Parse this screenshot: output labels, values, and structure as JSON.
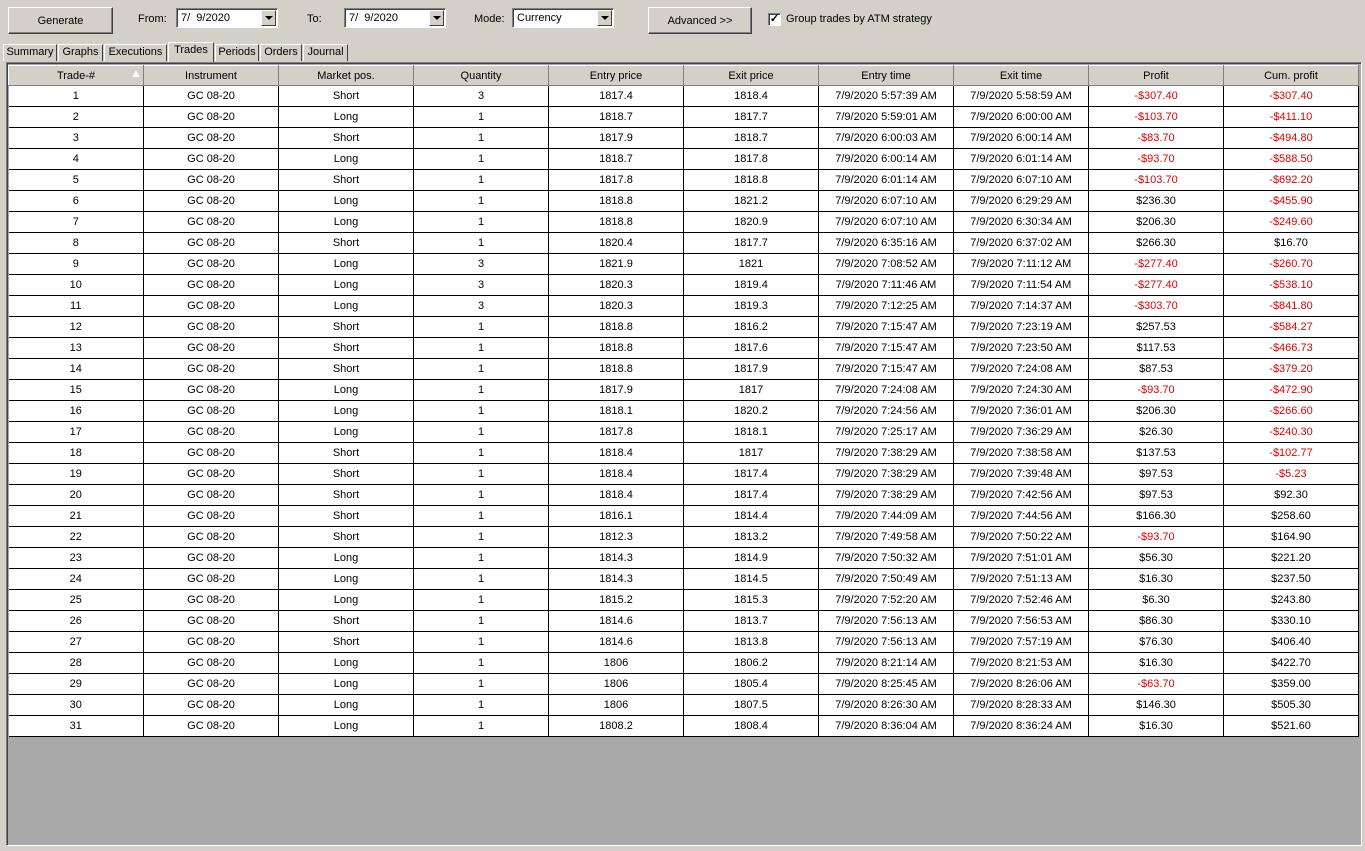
{
  "toolbar": {
    "generate_label": "Generate",
    "from_label": "From:",
    "from_value": "7/  9/2020",
    "to_label": "To:",
    "to_value": "7/  9/2020",
    "mode_label": "Mode:",
    "mode_value": "Currency",
    "advanced_label": "Advanced >>",
    "group_checkbox_label": "Group trades by ATM strategy",
    "group_checked": "✓"
  },
  "tabs": [
    "Summary",
    "Graphs",
    "Executions",
    "Trades",
    "Periods",
    "Orders",
    "Journal"
  ],
  "active_tab": "Trades",
  "colors": {
    "negative": "#e00000",
    "background": "#d4d0c8",
    "empty_grid": "#a9a9a9"
  },
  "table": {
    "columns": [
      "Trade-#",
      "Instrument",
      "Market pos.",
      "Quantity",
      "Entry price",
      "Exit price",
      "Entry time",
      "Exit time",
      "Profit",
      "Cum. profit"
    ],
    "sort_icon": "sort-ascending-icon",
    "rows": [
      [
        "1",
        "GC 08-20",
        "Short",
        "3",
        "1817.4",
        "1818.4",
        "7/9/2020 5:57:39 AM",
        "7/9/2020 5:58:59 AM",
        "-$307.40",
        "-$307.40"
      ],
      [
        "2",
        "GC 08-20",
        "Long",
        "1",
        "1818.7",
        "1817.7",
        "7/9/2020 5:59:01 AM",
        "7/9/2020 6:00:00 AM",
        "-$103.70",
        "-$411.10"
      ],
      [
        "3",
        "GC 08-20",
        "Short",
        "1",
        "1817.9",
        "1818.7",
        "7/9/2020 6:00:03 AM",
        "7/9/2020 6:00:14 AM",
        "-$83.70",
        "-$494.80"
      ],
      [
        "4",
        "GC 08-20",
        "Long",
        "1",
        "1818.7",
        "1817.8",
        "7/9/2020 6:00:14 AM",
        "7/9/2020 6:01:14 AM",
        "-$93.70",
        "-$588.50"
      ],
      [
        "5",
        "GC 08-20",
        "Short",
        "1",
        "1817.8",
        "1818.8",
        "7/9/2020 6:01:14 AM",
        "7/9/2020 6:07:10 AM",
        "-$103.70",
        "-$692.20"
      ],
      [
        "6",
        "GC 08-20",
        "Long",
        "1",
        "1818.8",
        "1821.2",
        "7/9/2020 6:07:10 AM",
        "7/9/2020 6:29:29 AM",
        "$236.30",
        "-$455.90"
      ],
      [
        "7",
        "GC 08-20",
        "Long",
        "1",
        "1818.8",
        "1820.9",
        "7/9/2020 6:07:10 AM",
        "7/9/2020 6:30:34 AM",
        "$206.30",
        "-$249.60"
      ],
      [
        "8",
        "GC 08-20",
        "Short",
        "1",
        "1820.4",
        "1817.7",
        "7/9/2020 6:35:16 AM",
        "7/9/2020 6:37:02 AM",
        "$266.30",
        "$16.70"
      ],
      [
        "9",
        "GC 08-20",
        "Long",
        "3",
        "1821.9",
        "1821",
        "7/9/2020 7:08:52 AM",
        "7/9/2020 7:11:12 AM",
        "-$277.40",
        "-$260.70"
      ],
      [
        "10",
        "GC 08-20",
        "Long",
        "3",
        "1820.3",
        "1819.4",
        "7/9/2020 7:11:46 AM",
        "7/9/2020 7:11:54 AM",
        "-$277.40",
        "-$538.10"
      ],
      [
        "11",
        "GC 08-20",
        "Long",
        "3",
        "1820.3",
        "1819.3",
        "7/9/2020 7:12:25 AM",
        "7/9/2020 7:14:37 AM",
        "-$303.70",
        "-$841.80"
      ],
      [
        "12",
        "GC 08-20",
        "Short",
        "1",
        "1818.8",
        "1816.2",
        "7/9/2020 7:15:47 AM",
        "7/9/2020 7:23:19 AM",
        "$257.53",
        "-$584.27"
      ],
      [
        "13",
        "GC 08-20",
        "Short",
        "1",
        "1818.8",
        "1817.6",
        "7/9/2020 7:15:47 AM",
        "7/9/2020 7:23:50 AM",
        "$117.53",
        "-$466.73"
      ],
      [
        "14",
        "GC 08-20",
        "Short",
        "1",
        "1818.8",
        "1817.9",
        "7/9/2020 7:15:47 AM",
        "7/9/2020 7:24:08 AM",
        "$87.53",
        "-$379.20"
      ],
      [
        "15",
        "GC 08-20",
        "Long",
        "1",
        "1817.9",
        "1817",
        "7/9/2020 7:24:08 AM",
        "7/9/2020 7:24:30 AM",
        "-$93.70",
        "-$472.90"
      ],
      [
        "16",
        "GC 08-20",
        "Long",
        "1",
        "1818.1",
        "1820.2",
        "7/9/2020 7:24:56 AM",
        "7/9/2020 7:36:01 AM",
        "$206.30",
        "-$266.60"
      ],
      [
        "17",
        "GC 08-20",
        "Long",
        "1",
        "1817.8",
        "1818.1",
        "7/9/2020 7:25:17 AM",
        "7/9/2020 7:36:29 AM",
        "$26.30",
        "-$240.30"
      ],
      [
        "18",
        "GC 08-20",
        "Short",
        "1",
        "1818.4",
        "1817",
        "7/9/2020 7:38:29 AM",
        "7/9/2020 7:38:58 AM",
        "$137.53",
        "-$102.77"
      ],
      [
        "19",
        "GC 08-20",
        "Short",
        "1",
        "1818.4",
        "1817.4",
        "7/9/2020 7:38:29 AM",
        "7/9/2020 7:39:48 AM",
        "$97.53",
        "-$5.23"
      ],
      [
        "20",
        "GC 08-20",
        "Short",
        "1",
        "1818.4",
        "1817.4",
        "7/9/2020 7:38:29 AM",
        "7/9/2020 7:42:56 AM",
        "$97.53",
        "$92.30"
      ],
      [
        "21",
        "GC 08-20",
        "Short",
        "1",
        "1816.1",
        "1814.4",
        "7/9/2020 7:44:09 AM",
        "7/9/2020 7:44:56 AM",
        "$166.30",
        "$258.60"
      ],
      [
        "22",
        "GC 08-20",
        "Short",
        "1",
        "1812.3",
        "1813.2",
        "7/9/2020 7:49:58 AM",
        "7/9/2020 7:50:22 AM",
        "-$93.70",
        "$164.90"
      ],
      [
        "23",
        "GC 08-20",
        "Long",
        "1",
        "1814.3",
        "1814.9",
        "7/9/2020 7:50:32 AM",
        "7/9/2020 7:51:01 AM",
        "$56.30",
        "$221.20"
      ],
      [
        "24",
        "GC 08-20",
        "Long",
        "1",
        "1814.3",
        "1814.5",
        "7/9/2020 7:50:49 AM",
        "7/9/2020 7:51:13 AM",
        "$16.30",
        "$237.50"
      ],
      [
        "25",
        "GC 08-20",
        "Long",
        "1",
        "1815.2",
        "1815.3",
        "7/9/2020 7:52:20 AM",
        "7/9/2020 7:52:46 AM",
        "$6.30",
        "$243.80"
      ],
      [
        "26",
        "GC 08-20",
        "Short",
        "1",
        "1814.6",
        "1813.7",
        "7/9/2020 7:56:13 AM",
        "7/9/2020 7:56:53 AM",
        "$86.30",
        "$330.10"
      ],
      [
        "27",
        "GC 08-20",
        "Short",
        "1",
        "1814.6",
        "1813.8",
        "7/9/2020 7:56:13 AM",
        "7/9/2020 7:57:19 AM",
        "$76.30",
        "$406.40"
      ],
      [
        "28",
        "GC 08-20",
        "Long",
        "1",
        "1806",
        "1806.2",
        "7/9/2020 8:21:14 AM",
        "7/9/2020 8:21:53 AM",
        "$16.30",
        "$422.70"
      ],
      [
        "29",
        "GC 08-20",
        "Long",
        "1",
        "1806",
        "1805.4",
        "7/9/2020 8:25:45 AM",
        "7/9/2020 8:26:06 AM",
        "-$63.70",
        "$359.00"
      ],
      [
        "30",
        "GC 08-20",
        "Long",
        "1",
        "1806",
        "1807.5",
        "7/9/2020 8:26:30 AM",
        "7/9/2020 8:28:33 AM",
        "$146.30",
        "$505.30"
      ],
      [
        "31",
        "GC 08-20",
        "Long",
        "1",
        "1808.2",
        "1808.4",
        "7/9/2020 8:36:04 AM",
        "7/9/2020 8:36:24 AM",
        "$16.30",
        "$521.60"
      ]
    ]
  }
}
